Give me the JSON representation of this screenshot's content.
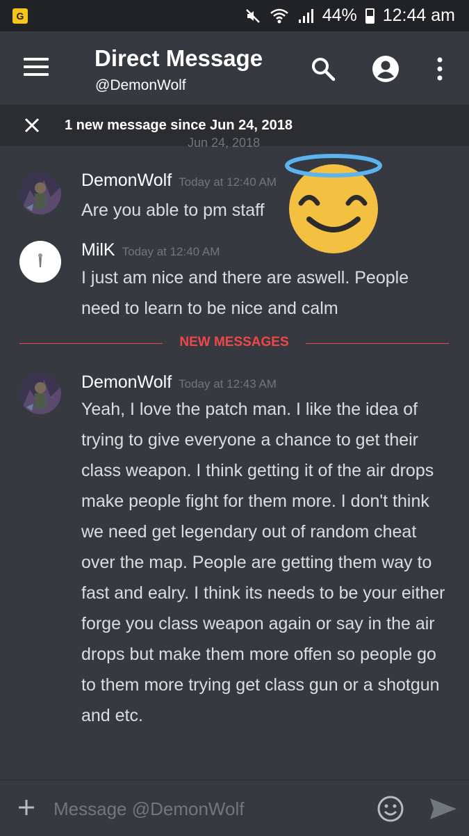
{
  "status_bar": {
    "battery": "44%",
    "time": "12:44 am"
  },
  "header": {
    "title": "Direct Message",
    "subtitle": "@DemonWolf"
  },
  "new_messages_bar": {
    "text": "1 new message since Jun 24, 2018"
  },
  "date_separator": "Jun 24, 2018",
  "messages": [
    {
      "author": "DemonWolf",
      "time": "Today at 12:40 AM",
      "text": "Are you able to pm staff"
    },
    {
      "author": "MilK",
      "time": "Today at 12:40 AM",
      "text": "I just am nice and there are aswell. People need to learn to be nice and calm"
    },
    {
      "author": "DemonWolf",
      "time": "Today at 12:43 AM",
      "text": "Yeah, I love the patch man. I like the idea of trying to give everyone a chance to get their class weapon. I think getting it of the air drops make people fight for them more. I don't think we need get legendary out of random cheat over the map. People are getting them way to fast and ealry. I think its needs to be your either forge you class weapon again or say in the air drops but make them more offen so people go to them more trying get class gun or a shotgun and etc."
    }
  ],
  "new_messages_divider": "NEW MESSAGES",
  "composer": {
    "placeholder": "Message @DemonWolf"
  },
  "colors": {
    "background": "#36393f",
    "status_bar": "#202225",
    "divider_red": "#f04747",
    "timestamp_gray": "#72767d"
  }
}
